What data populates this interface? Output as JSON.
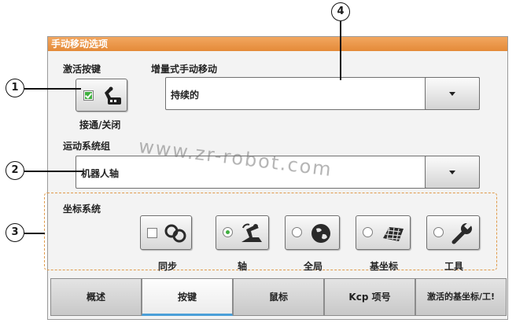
{
  "panel": {
    "title": "手动移动选项"
  },
  "activation": {
    "label": "激活按键",
    "toggle_label": "接通/关闭",
    "checked": true,
    "icon": "robot-teach-icon"
  },
  "incremental": {
    "label": "增量式手动移动",
    "value": "持续的",
    "dropdown_icon": "chevron-down-icon"
  },
  "motion_group": {
    "label": "运动系统组",
    "value": "机器人轴",
    "dropdown_icon": "chevron-down-icon"
  },
  "coordinate_system": {
    "label": "坐标系统",
    "options": [
      {
        "label": "同步",
        "control": "checkbox",
        "selected": false,
        "icon": "sync-link-icon"
      },
      {
        "label": "轴",
        "control": "radio",
        "selected": true,
        "icon": "axis-robot-icon"
      },
      {
        "label": "全局",
        "control": "radio",
        "selected": false,
        "icon": "globe-icon"
      },
      {
        "label": "基坐标",
        "control": "radio",
        "selected": false,
        "icon": "base-grid-icon"
      },
      {
        "label": "工具",
        "control": "radio",
        "selected": false,
        "icon": "wrench-icon"
      }
    ]
  },
  "tabs": [
    {
      "label": "概述",
      "active": false
    },
    {
      "label": "按键",
      "active": true
    },
    {
      "label": "鼠标",
      "active": false
    },
    {
      "label": "Kcp 项号",
      "active": false
    },
    {
      "label": "激活的基坐标/工!",
      "active": false
    }
  ],
  "callouts": [
    "1",
    "2",
    "3",
    "4"
  ],
  "watermark": "www.zr-robot.com",
  "colors": {
    "title_bar": "#e8913e",
    "dashed_border": "#e09a4a",
    "active_tab_underline": "#4b9fd8",
    "selected_indicator": "#3fae3f"
  }
}
